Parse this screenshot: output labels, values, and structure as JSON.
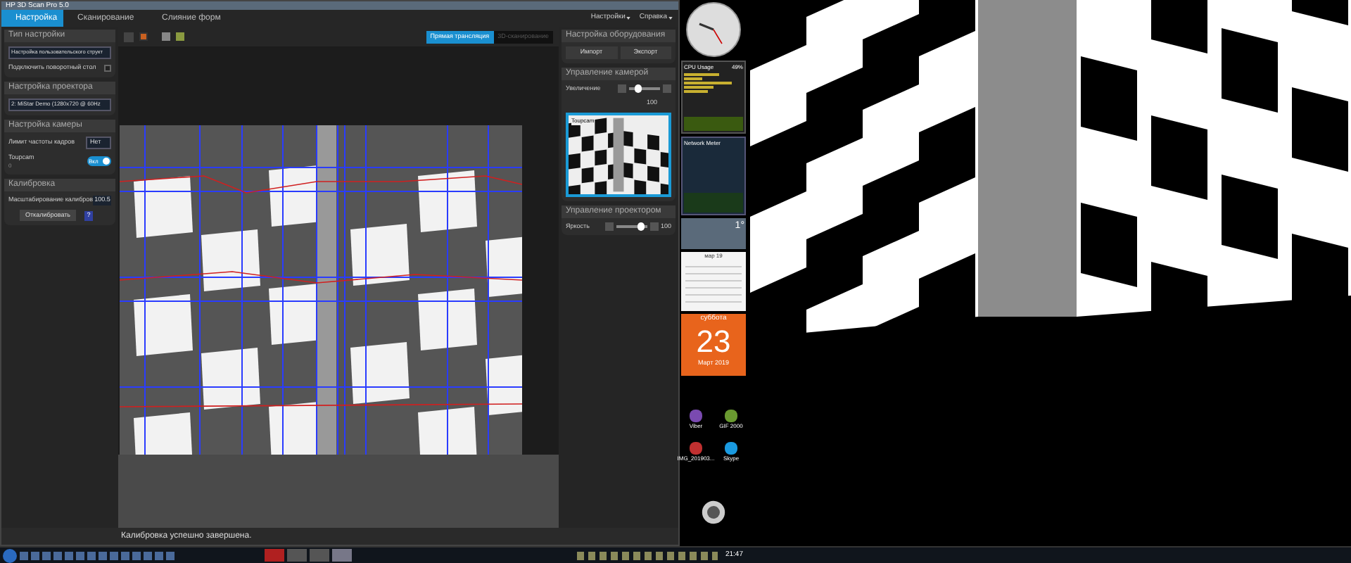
{
  "window": {
    "title": "HP 3D Scan Pro 5.0"
  },
  "tabs": [
    {
      "label": "Настройка",
      "selected": true
    },
    {
      "label": "Сканирование",
      "selected": false
    },
    {
      "label": "Слияние форм",
      "selected": false
    }
  ],
  "top_menu": [
    "Настройки",
    "Справка"
  ],
  "left_panel": {
    "setup_type": {
      "title": "Тип настройки",
      "dropdown": "Настройка пользовательского структ",
      "turntable": {
        "label": "Подключить поворотный стол",
        "checked": false
      }
    },
    "projector": {
      "title": "Настройка проектора",
      "dropdown": "2: MiStar Demo (1280x720 @ 60Hz"
    },
    "camera": {
      "title": "Настройка камеры",
      "fps_label": "Лимит частоты кадров",
      "fps_value": "Нет",
      "device": "Toupcam",
      "device_sub": "0",
      "toggle_label": "Вкл",
      "on": true
    },
    "calibration": {
      "title": "Калибровка",
      "scale_label": "Масштабирование калибров",
      "scale_value": "100.5",
      "button": "Откалибровать",
      "help": "?"
    }
  },
  "view_modes": [
    {
      "label": "Прямая трансляция",
      "selected": true
    },
    {
      "label": "3D-сканирование",
      "selected": false
    }
  ],
  "right_panel": {
    "hardware": {
      "title": "Настройка оборудования",
      "buttons": [
        "Импорт",
        "Экспорт"
      ]
    },
    "camera_control": {
      "title": "Управление камерой",
      "zoom_label": "Увеличение",
      "zoom": {
        "level": 0.25
      },
      "zoom_value": "100",
      "thumbnail_label": "Toupcam"
    },
    "projector_control": {
      "title": "Управление проектором",
      "brightness_label": "Яркость",
      "brightness": {
        "level": 0.75
      },
      "brightness_value": "100"
    }
  },
  "status_bar": "Калибровка успешно завершена.",
  "gadgets": {
    "cpu_title": "CPU Usage",
    "cpu_value": "49%",
    "network_title": "Network Meter",
    "weather_temp": "1°",
    "calendar_month": "мар 19",
    "weekday": "суббота",
    "day": "23",
    "month_year": "Март 2019"
  },
  "desktop_icons": [
    "Viber",
    "GIF 2000",
    "IMG_201903...",
    "Skype"
  ],
  "taskbar": {
    "time": "21:47"
  }
}
